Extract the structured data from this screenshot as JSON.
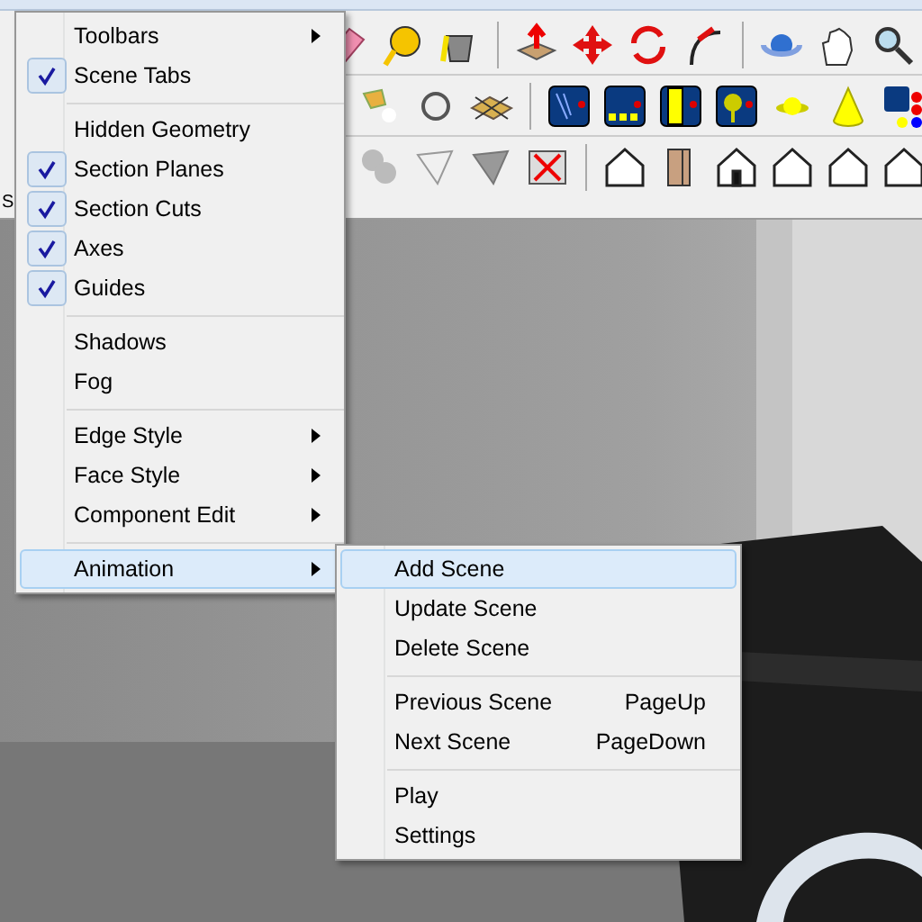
{
  "toolbar": {
    "cut_label": "S"
  },
  "view_menu": {
    "items": [
      {
        "kind": "item",
        "label": "Toolbars",
        "checked": false,
        "submenu": true,
        "selected": false
      },
      {
        "kind": "item",
        "label": "Scene Tabs",
        "checked": true,
        "submenu": false,
        "selected": false
      },
      {
        "kind": "separator"
      },
      {
        "kind": "item",
        "label": "Hidden Geometry",
        "checked": false,
        "submenu": false,
        "selected": false
      },
      {
        "kind": "item",
        "label": "Section Planes",
        "checked": true,
        "submenu": false,
        "selected": false
      },
      {
        "kind": "item",
        "label": "Section Cuts",
        "checked": true,
        "submenu": false,
        "selected": false
      },
      {
        "kind": "item",
        "label": "Axes",
        "checked": true,
        "submenu": false,
        "selected": false
      },
      {
        "kind": "item",
        "label": "Guides",
        "checked": true,
        "submenu": false,
        "selected": false
      },
      {
        "kind": "separator"
      },
      {
        "kind": "item",
        "label": "Shadows",
        "checked": false,
        "submenu": false,
        "selected": false
      },
      {
        "kind": "item",
        "label": "Fog",
        "checked": false,
        "submenu": false,
        "selected": false
      },
      {
        "kind": "separator"
      },
      {
        "kind": "item",
        "label": "Edge Style",
        "checked": false,
        "submenu": true,
        "selected": false
      },
      {
        "kind": "item",
        "label": "Face Style",
        "checked": false,
        "submenu": true,
        "selected": false
      },
      {
        "kind": "item",
        "label": "Component Edit",
        "checked": false,
        "submenu": true,
        "selected": false
      },
      {
        "kind": "separator"
      },
      {
        "kind": "item",
        "label": "Animation",
        "checked": false,
        "submenu": true,
        "selected": true
      }
    ]
  },
  "animation_submenu": {
    "items": [
      {
        "kind": "item",
        "label": "Add Scene",
        "selected": true
      },
      {
        "kind": "item",
        "label": "Update Scene",
        "selected": false
      },
      {
        "kind": "item",
        "label": "Delete Scene",
        "selected": false
      },
      {
        "kind": "separator"
      },
      {
        "kind": "item",
        "label": "Previous Scene",
        "shortcut": "PageUp",
        "selected": false
      },
      {
        "kind": "item",
        "label": "Next Scene",
        "shortcut": "PageDown",
        "selected": false
      },
      {
        "kind": "separator"
      },
      {
        "kind": "item",
        "label": "Play",
        "selected": false
      },
      {
        "kind": "item",
        "label": "Settings",
        "selected": false
      }
    ]
  }
}
